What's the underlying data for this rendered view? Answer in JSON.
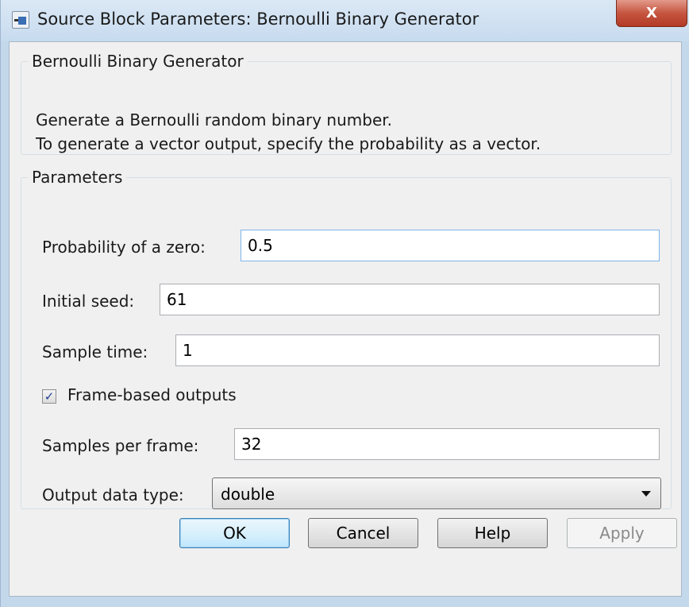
{
  "window": {
    "title": "Source Block Parameters: Bernoulli Binary Generator",
    "close_label": "X"
  },
  "description": {
    "group_title": "Bernoulli Binary Generator",
    "line1": "Generate a Bernoulli random binary number.",
    "line2": "To generate a vector output, specify the probability as a vector."
  },
  "parameters": {
    "group_title": "Parameters",
    "probability_label": "Probability of a zero:",
    "probability_value": "0.5",
    "seed_label": "Initial seed:",
    "seed_value": "61",
    "sample_time_label": "Sample time:",
    "sample_time_value": "1",
    "frame_based_label": "Frame-based outputs",
    "frame_based_checked": true,
    "samples_per_frame_label": "Samples per frame:",
    "samples_per_frame_value": "32",
    "output_type_label": "Output data type:",
    "output_type_value": "double"
  },
  "buttons": {
    "ok": "OK",
    "cancel": "Cancel",
    "help": "Help",
    "apply": "Apply"
  }
}
